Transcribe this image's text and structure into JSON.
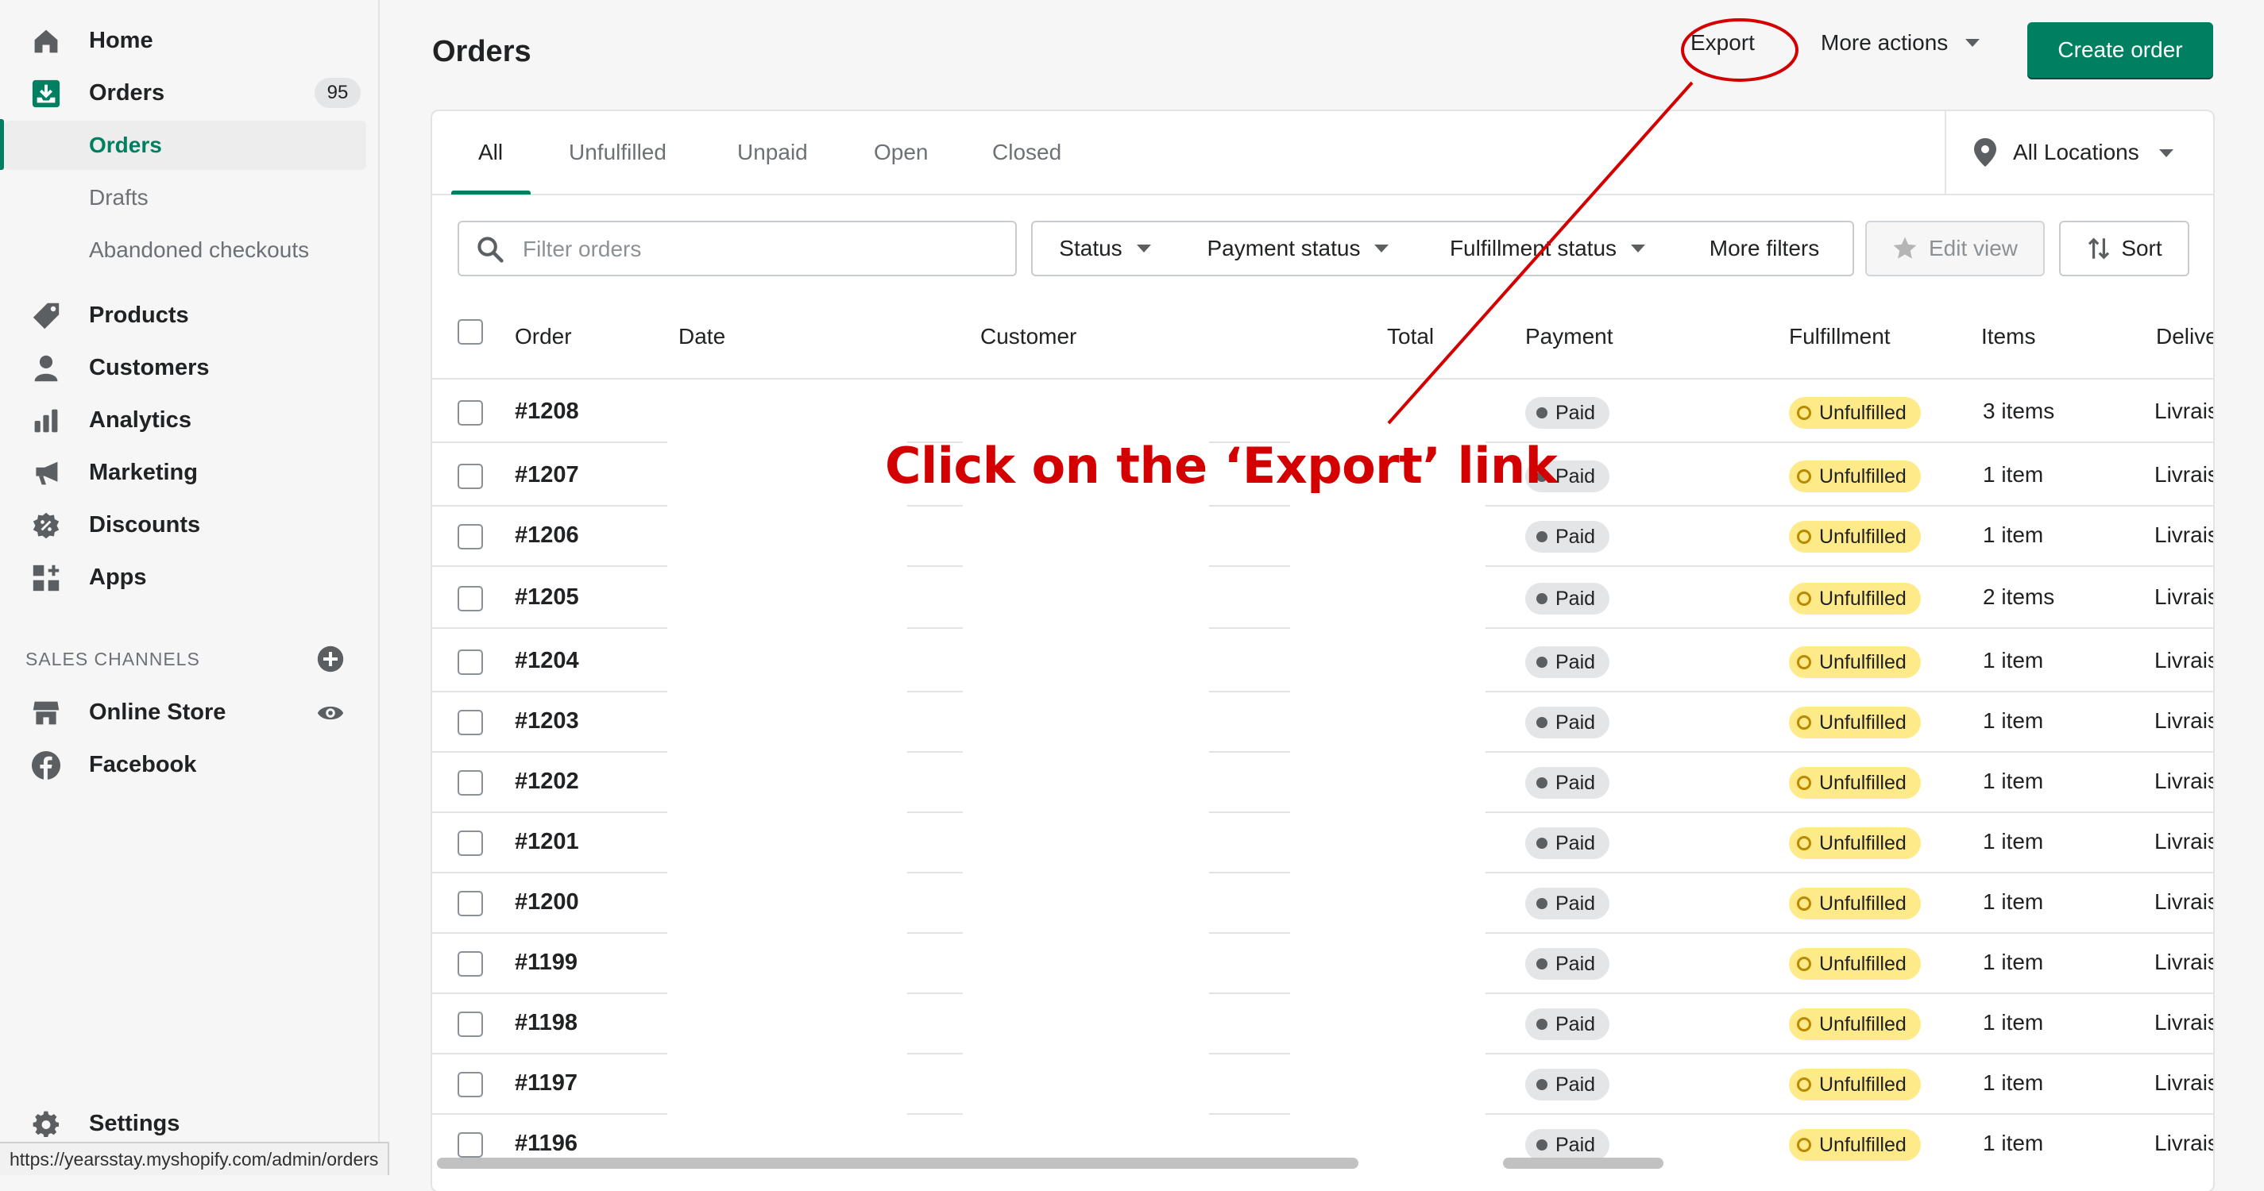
{
  "sidebar": {
    "nav": [
      {
        "label": "Home",
        "icon": "home-icon"
      },
      {
        "label": "Orders",
        "icon": "orders-icon",
        "count": "95"
      },
      {
        "label": "Products",
        "icon": "tag-icon"
      },
      {
        "label": "Customers",
        "icon": "person-icon"
      },
      {
        "label": "Analytics",
        "icon": "bar-chart-icon"
      },
      {
        "label": "Marketing",
        "icon": "megaphone-icon"
      },
      {
        "label": "Discounts",
        "icon": "discount-icon"
      },
      {
        "label": "Apps",
        "icon": "apps-icon"
      }
    ],
    "orders_sub": [
      "Orders",
      "Drafts",
      "Abandoned checkouts"
    ],
    "sales_channels_heading": "SALES CHANNELS",
    "channels": [
      {
        "label": "Online Store",
        "icon": "store-icon"
      },
      {
        "label": "Facebook",
        "icon": "facebook-icon"
      }
    ],
    "settings": "Settings"
  },
  "status_url": "https://yearsstay.myshopify.com/admin/orders",
  "header": {
    "title": "Orders",
    "export": "Export",
    "more_actions": "More actions",
    "create_order": "Create order"
  },
  "tabs": [
    "All",
    "Unfulfilled",
    "Unpaid",
    "Open",
    "Closed"
  ],
  "locations": "All Locations",
  "filters": {
    "search_placeholder": "Filter orders",
    "status": "Status",
    "payment_status": "Payment status",
    "fulfillment_status": "Fulfillment status",
    "more_filters": "More filters",
    "edit_view": "Edit view",
    "sort": "Sort"
  },
  "table": {
    "columns": [
      "Order",
      "Date",
      "Customer",
      "Total",
      "Payment",
      "Fulfillment",
      "Items",
      "Delive"
    ],
    "rows": [
      {
        "order": "#1208",
        "payment": "Paid",
        "fulfillment": "Unfulfilled",
        "items": "3 items",
        "delivery": "Livrais"
      },
      {
        "order": "#1207",
        "payment": "Paid",
        "fulfillment": "Unfulfilled",
        "items": "1 item",
        "delivery": "Livrais"
      },
      {
        "order": "#1206",
        "payment": "Paid",
        "fulfillment": "Unfulfilled",
        "items": "1 item",
        "delivery": "Livrais"
      },
      {
        "order": "#1205",
        "payment": "Paid",
        "fulfillment": "Unfulfilled",
        "items": "2 items",
        "delivery": "Livrais"
      },
      {
        "order": "#1204",
        "payment": "Paid",
        "fulfillment": "Unfulfilled",
        "items": "1 item",
        "delivery": "Livrais"
      },
      {
        "order": "#1203",
        "payment": "Paid",
        "fulfillment": "Unfulfilled",
        "items": "1 item",
        "delivery": "Livrais"
      },
      {
        "order": "#1202",
        "payment": "Paid",
        "fulfillment": "Unfulfilled",
        "items": "1 item",
        "delivery": "Livrais"
      },
      {
        "order": "#1201",
        "payment": "Paid",
        "fulfillment": "Unfulfilled",
        "items": "1 item",
        "delivery": "Livrais"
      },
      {
        "order": "#1200",
        "payment": "Paid",
        "fulfillment": "Unfulfilled",
        "items": "1 item",
        "delivery": "Livrais"
      },
      {
        "order": "#1199",
        "payment": "Paid",
        "fulfillment": "Unfulfilled",
        "items": "1 item",
        "delivery": "Livrais"
      },
      {
        "order": "#1198",
        "payment": "Paid",
        "fulfillment": "Unfulfilled",
        "items": "1 item",
        "delivery": "Livrais"
      },
      {
        "order": "#1197",
        "payment": "Paid",
        "fulfillment": "Unfulfilled",
        "items": "1 item",
        "delivery": "Livrais"
      },
      {
        "order": "#1196",
        "payment": "Paid",
        "fulfillment": "Unfulfilled",
        "items": "1 item",
        "delivery": "Livrais"
      }
    ]
  },
  "annotation": {
    "text": "Click on the ‘Export’ link",
    "color": "#d40000"
  },
  "colors": {
    "accent": "#008060",
    "paid_badge": "#e4e5e7",
    "unfulfilled_badge": "#ffea8a"
  }
}
